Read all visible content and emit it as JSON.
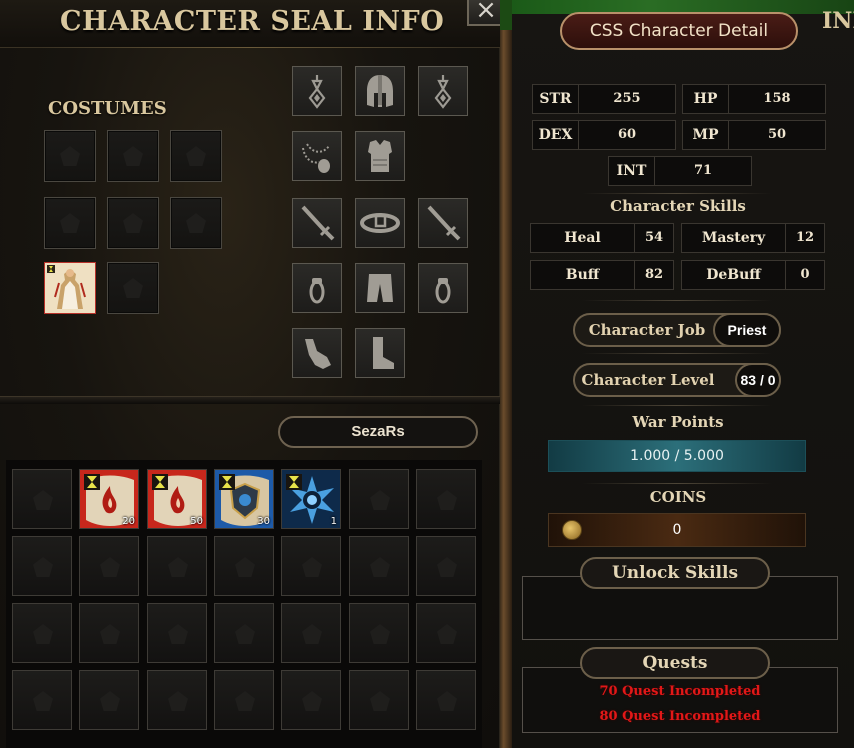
{
  "seal_window": {
    "title": "CHARACTER SEAL INFO",
    "close_label": "×",
    "costumes_label": "COSTUMES",
    "character_name": "SezaRs",
    "equipment_icons": [
      "earring-icon",
      "helmet-icon",
      "earring-icon",
      "necklace-icon",
      "armor-icon",
      "sword-icon",
      "belt-icon",
      "sword-icon",
      "ring-icon",
      "pants-icon",
      "ring-icon",
      "glove-icon",
      "boot-icon"
    ],
    "inventory_items": [
      {
        "icon": "red-scroll-icon",
        "count": "20"
      },
      {
        "icon": "red-scroll-icon",
        "count": "50"
      },
      {
        "icon": "shield-scroll-icon",
        "count": "30"
      },
      {
        "icon": "blue-star-gem-icon",
        "count": "1"
      }
    ]
  },
  "detail": {
    "title": "CSS Character Detail",
    "top_right_label": "INI",
    "stats": [
      {
        "label": "STR",
        "value": "255"
      },
      {
        "label": "HP",
        "value": "158"
      },
      {
        "label": "DEX",
        "value": "60"
      },
      {
        "label": "MP",
        "value": "50"
      },
      {
        "label": "INT",
        "value": "71"
      }
    ],
    "skills_title": "Character Skills",
    "skills": [
      {
        "label": "Heal",
        "value": "54"
      },
      {
        "label": "Mastery",
        "value": "12"
      },
      {
        "label": "Buff",
        "value": "82"
      },
      {
        "label": "DeBuff",
        "value": "0"
      }
    ],
    "job_label": "Character Job",
    "job_value": "Priest",
    "level_label": "Character Level",
    "level_value": "83 / 0",
    "war_points_title": "War Points",
    "war_points_value": "1.000 / 5.000",
    "coins_title": "COINS",
    "coins_value": "0",
    "unlock_skills_label": "Unlock Skills",
    "quests_label": "Quests",
    "quests": [
      "70 Quest Incompleted",
      "80 Quest Incompleted"
    ]
  },
  "colors": {
    "accent_gold": "#d9c79e",
    "quest_incomplete": "#e21818",
    "war_bar": "#2c6f7a",
    "title_pill": "#4a1c16"
  }
}
